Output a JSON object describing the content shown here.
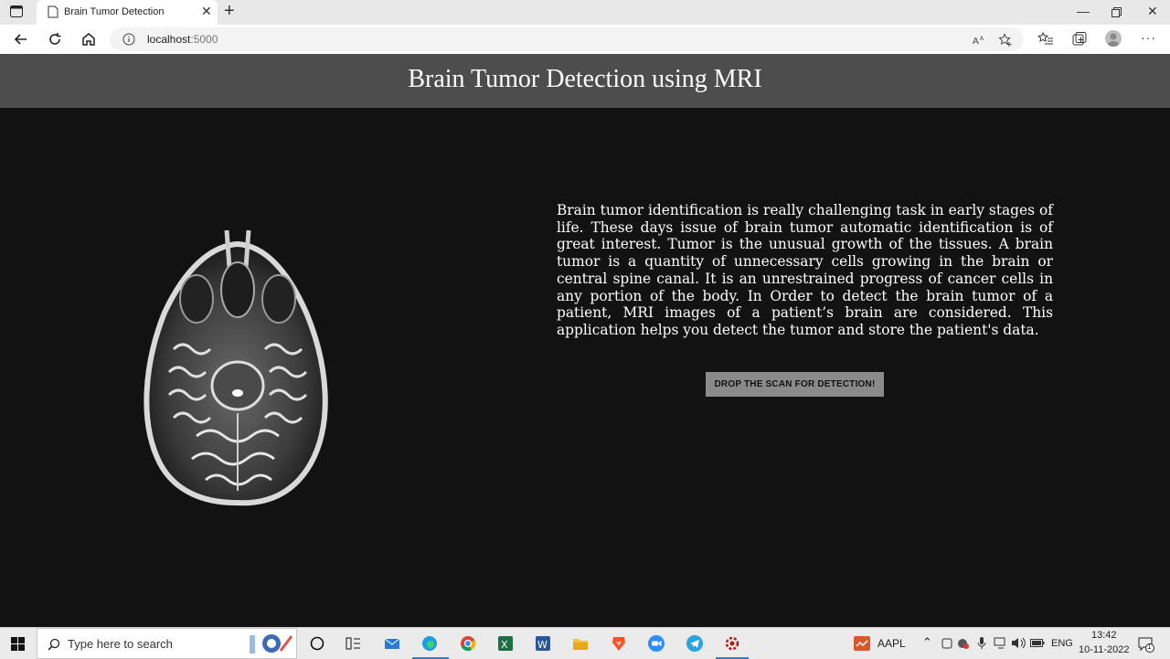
{
  "browser": {
    "tab_title": "Brain Tumor Detection",
    "url_host": "localhost",
    "url_port": ":5000"
  },
  "page": {
    "heading": "Brain Tumor Detection using MRI",
    "description": "Brain tumor identification is really challenging task in early stages of life. These days issue of brain tumor automatic identification is of great interest. Tumor is the unusual growth of the tissues. A brain tumor is a quantity of unnecessary cells growing in the brain or central spine canal. It is an unrestrained progress of cancer cells in any portion of the body. In Order to detect the brain tumor of a patient, MRI images of a patient’s brain are considered. This application helps you detect the tumor and store the patient's data.",
    "button_label": "DROP THE SCAN FOR DETECTION!",
    "image_semantic": "brain-mri-scan"
  },
  "taskbar": {
    "search_placeholder": "Type here to search",
    "apps": [
      "task-view",
      "mail",
      "edge",
      "chrome",
      "excel",
      "word",
      "file-explorer",
      "brave",
      "zoom",
      "telegram",
      "settings-gear"
    ],
    "stock_label": "AAPL",
    "language": "ENG",
    "time": "13:42",
    "date": "10-11-2022",
    "notification_count": "1"
  },
  "colors": {
    "header_bg": "#4d4d4d",
    "page_bg": "#121212",
    "button_bg": "#8a8a8a",
    "accent": "#3b78d8"
  }
}
